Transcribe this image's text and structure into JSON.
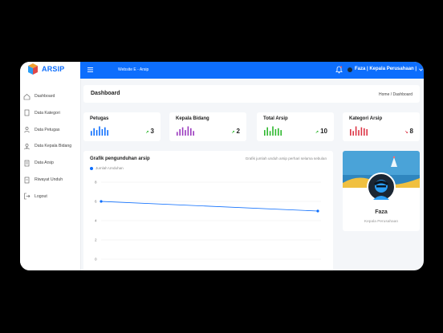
{
  "app": {
    "brand": "ARSIP",
    "site_title": "Website E - Arsip"
  },
  "user": {
    "label": "Faza | Kepala Perusahaan |"
  },
  "sidebar": {
    "items": [
      {
        "label": "Dashboard",
        "icon": "home-icon"
      },
      {
        "label": "Data Kategori",
        "icon": "file-icon"
      },
      {
        "label": "Data Petugas",
        "icon": "users-icon"
      },
      {
        "label": "Data Kepala Bidang",
        "icon": "user-tie-icon"
      },
      {
        "label": "Data Arsip",
        "icon": "document-icon"
      },
      {
        "label": "Riwayat Unduh",
        "icon": "history-icon"
      },
      {
        "label": "Logout",
        "icon": "logout-icon"
      }
    ]
  },
  "header": {
    "title": "Dashboard",
    "breadcrumb": "Home / Dashboard"
  },
  "stats": [
    {
      "title": "Petugas",
      "value": "3",
      "trend": "up",
      "color": "#0d6efd"
    },
    {
      "title": "Kepala Bidang",
      "value": "2",
      "trend": "up",
      "color": "#9b3bbf"
    },
    {
      "title": "Total Arsip",
      "value": "10",
      "trend": "up",
      "color": "#2eb82e"
    },
    {
      "title": "Kategori Arsip",
      "value": "8",
      "trend": "down",
      "color": "#dc3545"
    }
  ],
  "chart": {
    "title": "Grafik pengunduhan arsip",
    "subtitle": "Grafik jumlah unduh arsip perhari selama sebulan"
  },
  "chart_data": {
    "type": "line",
    "series": [
      {
        "name": "Jumlah Unduhan",
        "values": [
          6,
          5
        ]
      }
    ],
    "x": [
      0,
      1
    ],
    "yticks": [
      "8",
      "6",
      "4",
      "2",
      "0"
    ],
    "ylim": [
      0,
      8
    ],
    "grid": true,
    "legend": "top-left",
    "color": "#0d6efd"
  },
  "profile": {
    "name": "Faza",
    "role": "Kepala Perusahaan"
  },
  "colors": {
    "primary": "#0d6efd",
    "background": "#f4f6f9"
  }
}
